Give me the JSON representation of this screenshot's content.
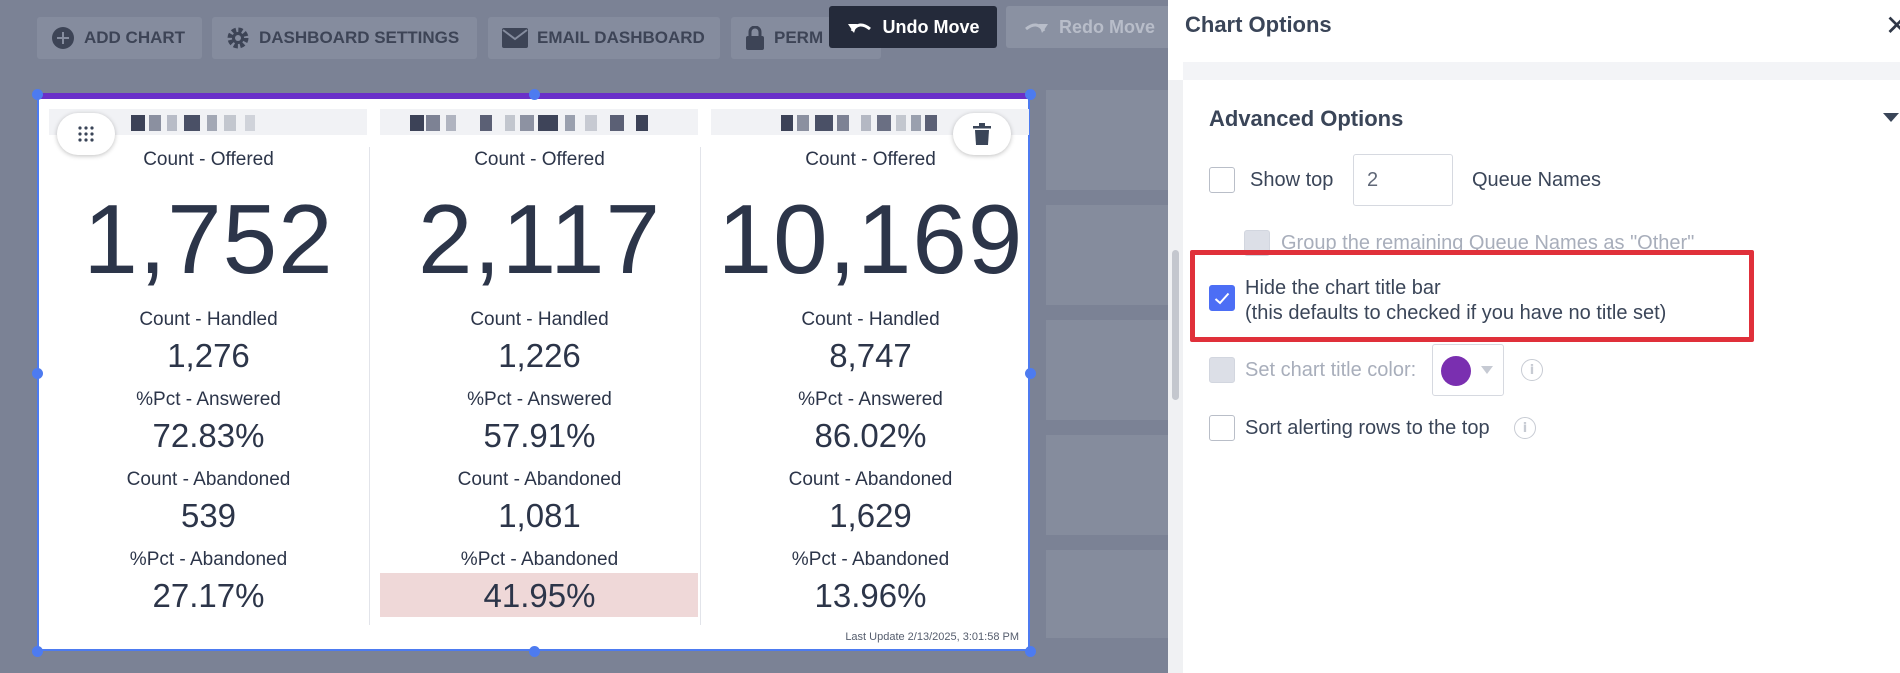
{
  "toolbar": {
    "add_chart": "ADD CHART",
    "dashboard_settings": "DASHBOARD SETTINGS",
    "email_dashboard": "EMAIL DASHBOARD",
    "permissions": "PERM",
    "undo": "Undo Move",
    "redo": "Redo Move"
  },
  "chart": {
    "columns": [
      {
        "offered_label": "Count - Offered",
        "offered": "1,752",
        "handled_label": "Count - Handled",
        "handled": "1,276",
        "answered_label": "%Pct - Answered",
        "answered": "72.83%",
        "abandoned_label": "Count - Abandoned",
        "abandoned": "539",
        "pct_abandoned_label": "%Pct - Abandoned",
        "pct_abandoned": "27.17%"
      },
      {
        "offered_label": "Count - Offered",
        "offered": "2,117",
        "handled_label": "Count - Handled",
        "handled": "1,226",
        "answered_label": "%Pct - Answered",
        "answered": "57.91%",
        "abandoned_label": "Count - Abandoned",
        "abandoned": "1,081",
        "pct_abandoned_label": "%Pct - Abandoned",
        "pct_abandoned": "41.95%"
      },
      {
        "offered_label": "Count - Offered",
        "offered": "10,169",
        "handled_label": "Count - Handled",
        "handled": "8,747",
        "answered_label": "%Pct - Answered",
        "answered": "86.02%",
        "abandoned_label": "Count - Abandoned",
        "abandoned": "1,629",
        "pct_abandoned_label": "%Pct - Abandoned",
        "pct_abandoned": "13.96%"
      }
    ],
    "last_update": "Last Update 2/13/2025, 3:01:58 PM",
    "colors": {
      "title_bar": "#6a30c8",
      "selection": "#4d7bf0",
      "alert_cell": "#efd8d8"
    },
    "icons": {
      "drag": "drag-grid-icon",
      "delete": "trash-icon"
    }
  },
  "panel": {
    "title": "Chart Options",
    "section": "Advanced Options",
    "show_top_label": "Show top",
    "show_top_value": "2",
    "queue_names_label": "Queue Names",
    "group_remaining_label": "Group the remaining Queue Names as \"Other\"",
    "hide_title_line1": "Hide the chart title bar",
    "hide_title_line2": "(this defaults to checked if you have no title set)",
    "title_color_label": "Set chart title color:",
    "title_color": "#7a2fb0",
    "sort_alerting_label": "Sort alerting rows to the top",
    "hide_title_checked": true,
    "highlight_color": "#e0303a"
  }
}
